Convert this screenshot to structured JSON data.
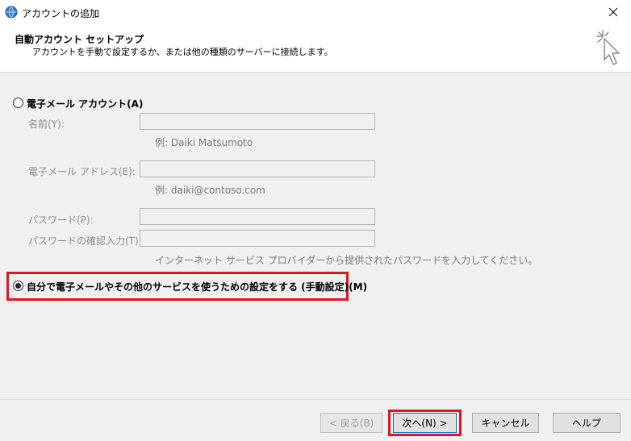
{
  "window": {
    "title": "アカウントの追加"
  },
  "header": {
    "title": "自動アカウント セットアップ",
    "subtitle": "アカウントを手動で設定するか、または他の種類のサーバーに接続します。"
  },
  "email_account": {
    "radio_label": "電子メール アカウント(A)",
    "checked": false,
    "name_label": "名前(Y):",
    "name_value": "",
    "name_hint": "例: Daiki Matsumoto",
    "email_label": "電子メール アドレス(E):",
    "email_value": "",
    "email_hint": "例: daiki@contoso.com",
    "password_label": "パスワード(P):",
    "password_value": "",
    "confirm_label": "パスワードの確認入力(T):",
    "confirm_value": "",
    "password_hint": "インターネット サービス プロバイダーから提供されたパスワードを入力してください。"
  },
  "manual_setup": {
    "radio_label": "自分で電子メールやその他のサービスを使うための設定をする (手動設定)(M)",
    "checked": true
  },
  "buttons": {
    "back": "< 戻る(B)",
    "next": "次へ(N) >",
    "cancel": "キャンセル",
    "help": "ヘルプ"
  },
  "colors": {
    "highlight": "#e0151f",
    "accent": "#0078d7"
  }
}
